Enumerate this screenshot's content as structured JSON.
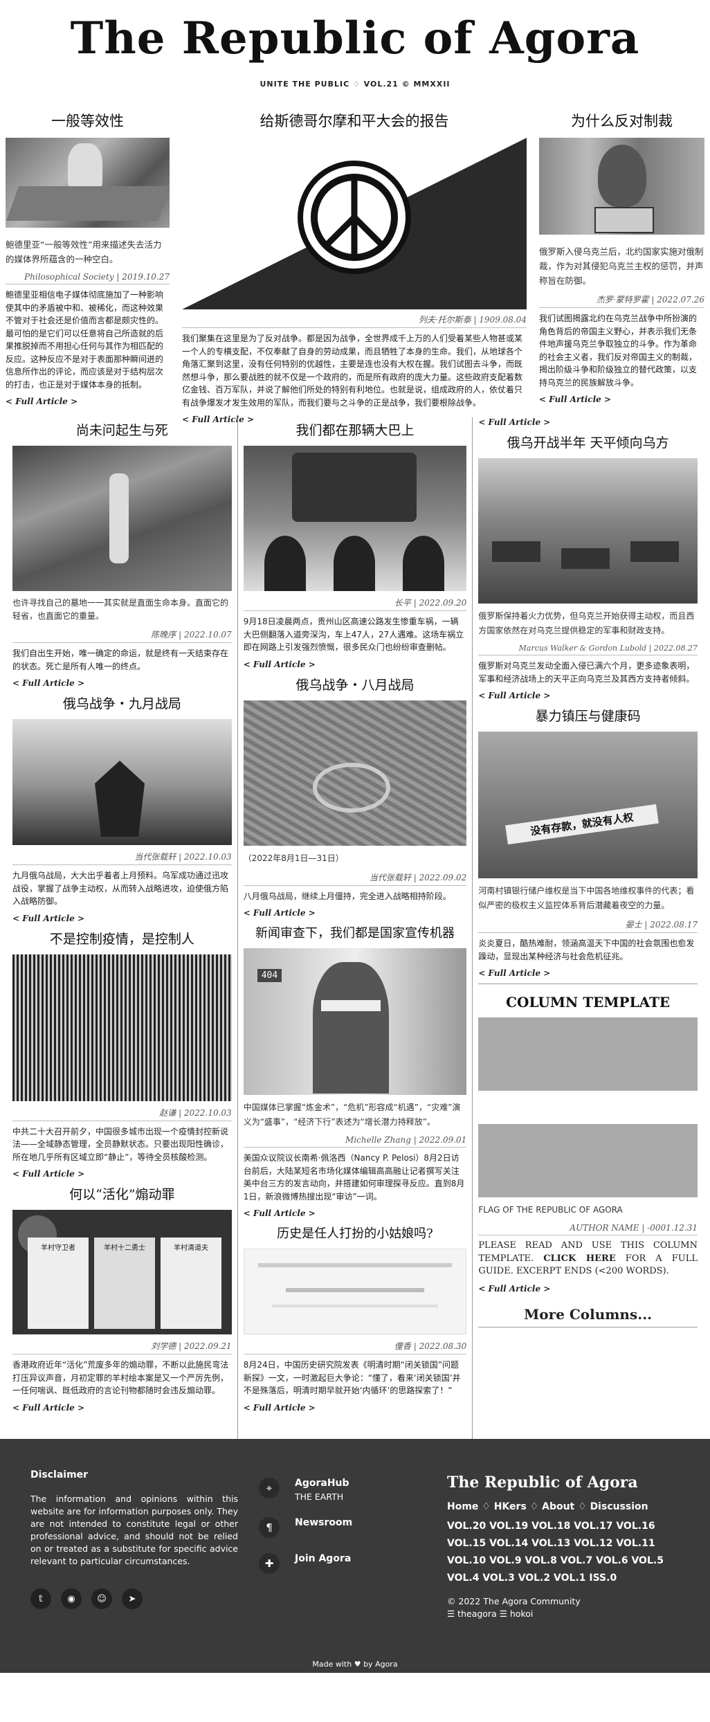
{
  "masthead": {
    "title": "The Republic of Agora",
    "issue": "UNITE THE PUBLIC ♢ VOL.21 © MMXXII"
  },
  "top": {
    "left": {
      "headline": "一般等效性",
      "caption": "鲍德里亚“一般等效性”用来描述失去活力的媒体界所蕴含的一种空白。",
      "byline": "Philosophical Society | 2019.10.27",
      "body": "鲍德里亚相信电子媒体彻底施加了一种影响使其中的矛盾被中和、被稀化，而这种效果不管对于社会还是价值而言都是颇灾性的。最可怕的是它们可以任意将自己所造就的后果推脱掉而不用担心任何与其作为相匹配的反应。这种反应不是对于表面那种瞬间迸的信息所作出的评论，而应该是对于结构层次的打击，也正是对于媒体本身的抵制。",
      "link": "< Full Article >"
    },
    "mid": {
      "headline": "给斯德哥尔摩和平大会的报告",
      "byline": "列夫·托尔斯泰 | 1909.08.04",
      "body": "我们聚集在这里是为了反对战争。都是因为战争，全世界成千上万的人们受着某些人物甚或某一个人的专横支配，不仅奉献了自身的劳动成果，而且牺牲了本身的生命。我们，从地球各个角落汇聚到这里，没有任何特别的优越性，主要是连也没有大权在握。我们试图去斗争，而既然想斗争，那么要战胜的就不仅是一个政府的，而是所有政府的庞大力量。这些政府支配着数亿金钱、百万军队，并说了解他们所处的特别有利地位。也就是说，组成政府的人，依仗着只有战争爆发才发生效用的军队，而我们要与之斗争的正是战争，我们要根除战争。",
      "link": "< Full Article >"
    },
    "right": {
      "headline": "为什么反对制裁",
      "caption": "俄罗斯入侵乌克兰后，北约国家实施对俄制裁，作为对其侵犯乌克兰主权的惩罚，并声称旨在防御。",
      "byline": "杰罗·蒙特罗霍 | 2022.07.26",
      "body": "我们试图揭露北约在乌克兰战争中所扮演的角色背后的帝国主义野心，并表示我们无条件地声援乌克兰争取独立的斗争。作为革命的社会主义者，我们反对帝国主义的制裁，揭出阶级斗争和阶级独立的替代政策，以支持乌克兰的民族解放斗争。",
      "link": "< Full Article >"
    }
  },
  "col1": [
    {
      "headline": "尚未问起生与死",
      "caption": "也许寻找自己的墓地一一其实就是直面生命本身。直面它的轻省，也直面它的重量。",
      "byline": "陈晚序 | 2022.10.07",
      "body": "我们自出生开始，唯一确定的命运，就是终有一天结束存在的状态。死亡是所有人唯一的终点。",
      "link": "< Full Article >"
    },
    {
      "headline": "俄乌战争・九月战局",
      "byline": "当代张载轩 | 2022.10.03",
      "body": "九月俄乌战局，大大出乎着者上月预料。乌军成功通过迅攻战役，掌握了战争主动权，从而转入战略进攻，迫使俄方陷入战略防御。",
      "link": "< Full Article >"
    },
    {
      "headline": "不是控制疫情，是控制人",
      "byline": "赵谦 | 2022.10.03",
      "body": "中共二十大召开前夕，中国很多城市出现一个疫情封控新说法——全域静态管理，全员静默状态。只要出现阳性确诊，所在地几乎所有区域立即“静止”，等待全员核酸检测。",
      "link": "< Full Article >"
    },
    {
      "headline": "何以“活化”煽动罪",
      "byline": "刘学德 | 2022.09.21",
      "body": "香港政府近年“活化”荒废多年的煽动罪，不断以此施民弯法打压异议声音，月初定罪的羊村绘本案是又一个严厉先例，一任何喘讽、既低政府的言论刊物都随时会违反煽动罪。",
      "link": "< Full Article >",
      "comic": [
        "羊村守卫者",
        "羊村十二勇士",
        "羊村清道夫"
      ]
    }
  ],
  "col2": [
    {
      "headline": "我们都在那辆大巴上",
      "byline": "长平 | 2022.09.20",
      "body": "9月18日凌晨两点，贵州山区高速公路发生惨重车祸，一辆大巴侧翻落入道旁深沟，车上47人，27人遇难。这场车祸立即在网路上引发强烈愤慨，很多民众门也纷纷审查删帖。",
      "link": "< Full Article >"
    },
    {
      "headline": "俄乌战争・八月战局",
      "caption": "（2022年8月1日—31日）",
      "byline": "当代张载轩 | 2022.09.02",
      "body": "八月俄乌战局，继续上月僵持，完全进入战略相持阶段。",
      "link": "< Full Article >"
    },
    {
      "headline": "新闻审查下，我们都是国家宣传机器",
      "caption": "中国媒体已掌握“炼金术”，“危机”形容成“机遇”，“灾难”演义为“盛事”，“经济下行”表述为“增长潜力持释放”。",
      "byline": "Michelle Zhang | 2022.09.01",
      "body": "美国众议院议长南希·佩洛西（Nancy P. Pelosi）8月2日访台前后，大陆某短名市场化媒体编辑高高融让记者撰写关注美中台三方的发言动向，并搭建如何审理探寻反应。直到8月1日，新浪微博热搜出现“审访”一词。",
      "link": "< Full Article >",
      "door": "404"
    },
    {
      "headline": "历史是任人打扮的小姑娘吗?",
      "byline": "僮香 | 2022.08.30",
      "body": "8月24日，中国历史研究院发表《明清时期“闭关锁国”问题新探》一文，一时激起巨大争论：“懂了，看来‘闭关锁国’并不是殊落后，明清时期早就开始‘内循环’的思路探索了！”",
      "link": "< Full Article >"
    }
  ],
  "col3": [
    {
      "top_link": "< Full Article >",
      "headline": "俄乌开战半年 天平倾向乌方",
      "caption": "俄罗斯保持着火力优势，但乌克兰开始获得主动权，而且西方国家依然在对乌克兰提供稳定的军事和财政支持。",
      "byline": "Marcus Walker & Gordon Lubold | 2022.08.27",
      "body": "俄罗斯对乌克兰发动全面入侵已满六个月，更多迹象表明，军事和经济战场上的天平正向乌克兰及其西方支持者倾斜。",
      "link": "< Full Article >"
    },
    {
      "headline": "暴力镇压与健康码",
      "caption": "河南村镇银行储户维权是当下中国各地维权事件的代表；看似严密的极权主义监控体系背后潜藏着夜空的力量。",
      "byline": "晏士 | 2022.08.17",
      "body": "炎炎夏日，酷热难耐，领涵高温天下中国的社会氛围也愈发躁动，显现出某种经济与社会危机征兆。",
      "link": "< Full Article >",
      "banner": "没有存款，就没有人权"
    },
    {
      "template_title": "COLUMN TEMPLATE",
      "flag": "FLAG OF THE REPUBLIC OF AGORA",
      "byline": "AUTHOR NAME | -0001.12.31",
      "body_pre": "PLEASE READ AND USE THIS COLUMN TEMPLATE. ",
      "body_bold": "CLICK HERE",
      "body_post": " FOR A FULL GUIDE. EXCERPT ENDS (<200 WORDS).",
      "link": "< Full Article >",
      "more": "More Columns..."
    }
  ],
  "footer": {
    "disclaimer_title": "Disclaimer",
    "disclaimer": "The information and opinions within this website are for information purposes only. They are not intended to constitute legal or other professional advice, and should not be relied on or treated as a substitute for specific advice relevant to particular circumstances.",
    "socials": [
      "twitter-icon",
      "github-icon",
      "discord-icon",
      "telegram-icon"
    ],
    "links": [
      {
        "icon": "location-icon",
        "title": "AgoraHub",
        "sub": "THE EARTH"
      },
      {
        "icon": "paragraph-icon",
        "title": "Newsroom",
        "sub": ""
      },
      {
        "icon": "puzzle-icon",
        "title": "Join Agora",
        "sub": ""
      }
    ],
    "brand": "The Republic of Agora",
    "nav": [
      "Home",
      "HKers",
      "About",
      "Discussion"
    ],
    "vols": "VOL.20 VOL.19 VOL.18 VOL.17 VOL.16 VOL.15 VOL.14 VOL.13 VOL.12 VOL.11 VOL.10 VOL.9 VOL.8 VOL.7 VOL.6 VOL.5 VOL.4 VOL.3 VOL.2 VOL.1 ISS.0",
    "copyright": "© 2022 The Agora Community",
    "credits": "☰ theagora ☰ hokoi",
    "made": "Made with ♥ by Agora"
  }
}
